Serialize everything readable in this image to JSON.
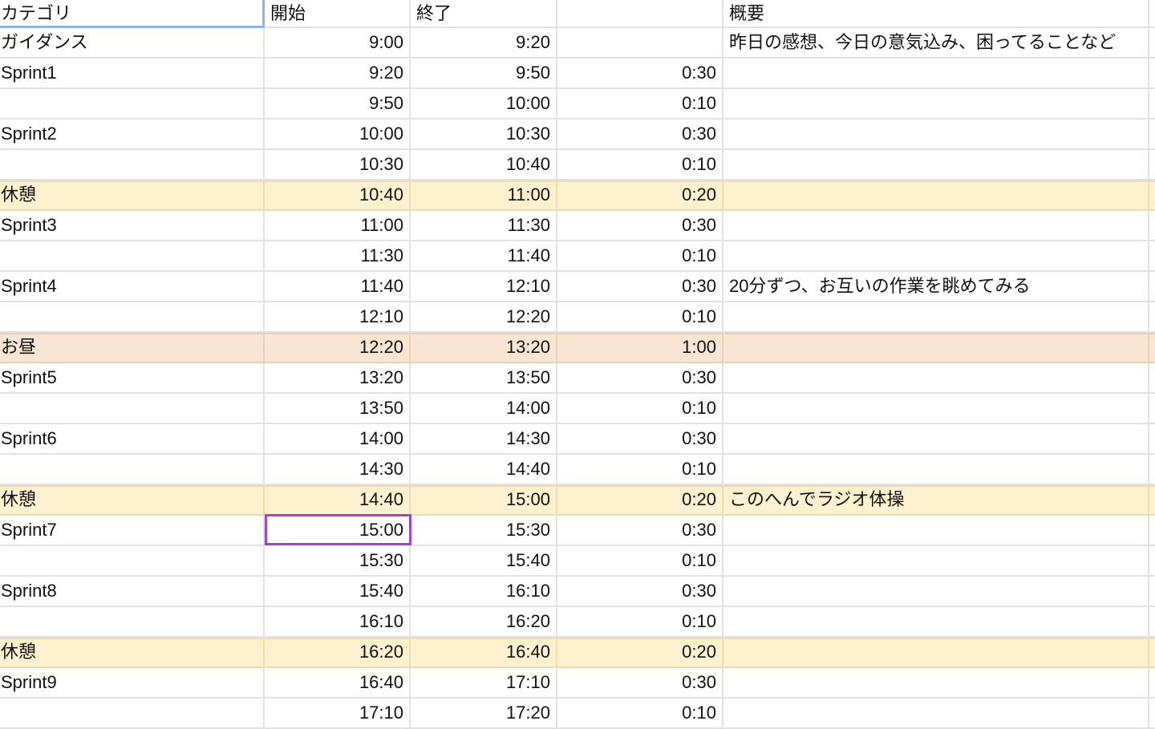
{
  "headers": [
    "カテゴリ",
    "開始",
    "終了",
    "",
    "概要"
  ],
  "rows": [
    {
      "category": "ガイダンス",
      "start": "9:00",
      "end": "9:20",
      "duration": "",
      "summary": "昨日の感想、今日の意気込み、困ってることなど",
      "type": "normal"
    },
    {
      "category": "Sprint1",
      "start": "9:20",
      "end": "9:50",
      "duration": "0:30",
      "summary": "",
      "type": "normal"
    },
    {
      "category": "",
      "start": "9:50",
      "end": "10:00",
      "duration": "0:10",
      "summary": "",
      "type": "normal"
    },
    {
      "category": "Sprint2",
      "start": "10:00",
      "end": "10:30",
      "duration": "0:30",
      "summary": "",
      "type": "normal"
    },
    {
      "category": "",
      "start": "10:30",
      "end": "10:40",
      "duration": "0:10",
      "summary": "",
      "type": "normal"
    },
    {
      "category": "休憩",
      "start": "10:40",
      "end": "11:00",
      "duration": "0:20",
      "summary": "",
      "type": "break"
    },
    {
      "category": "Sprint3",
      "start": "11:00",
      "end": "11:30",
      "duration": "0:30",
      "summary": "",
      "type": "normal"
    },
    {
      "category": "",
      "start": "11:30",
      "end": "11:40",
      "duration": "0:10",
      "summary": "",
      "type": "normal"
    },
    {
      "category": "Sprint4",
      "start": "11:40",
      "end": "12:10",
      "duration": "0:30",
      "summary": "20分ずつ、お互いの作業を眺めてみる",
      "type": "normal"
    },
    {
      "category": "",
      "start": "12:10",
      "end": "12:20",
      "duration": "0:10",
      "summary": "",
      "type": "normal"
    },
    {
      "category": "お昼",
      "start": "12:20",
      "end": "13:20",
      "duration": "1:00",
      "summary": "",
      "type": "lunch"
    },
    {
      "category": "Sprint5",
      "start": "13:20",
      "end": "13:50",
      "duration": "0:30",
      "summary": "",
      "type": "normal"
    },
    {
      "category": "",
      "start": "13:50",
      "end": "14:00",
      "duration": "0:10",
      "summary": "",
      "type": "normal"
    },
    {
      "category": "Sprint6",
      "start": "14:00",
      "end": "14:30",
      "duration": "0:30",
      "summary": "",
      "type": "normal"
    },
    {
      "category": "",
      "start": "14:30",
      "end": "14:40",
      "duration": "0:10",
      "summary": "",
      "type": "normal"
    },
    {
      "category": "休憩",
      "start": "14:40",
      "end": "15:00",
      "duration": "0:20",
      "summary": "このへんでラジオ体操",
      "type": "break"
    },
    {
      "category": "Sprint7",
      "start": "15:00",
      "end": "15:30",
      "duration": "0:30",
      "summary": "",
      "type": "normal"
    },
    {
      "category": "",
      "start": "15:30",
      "end": "15:40",
      "duration": "0:10",
      "summary": "",
      "type": "normal"
    },
    {
      "category": "Sprint8",
      "start": "15:40",
      "end": "16:10",
      "duration": "0:30",
      "summary": "",
      "type": "normal"
    },
    {
      "category": "",
      "start": "16:10",
      "end": "16:20",
      "duration": "0:10",
      "summary": "",
      "type": "normal"
    },
    {
      "category": "休憩",
      "start": "16:20",
      "end": "16:40",
      "duration": "0:20",
      "summary": "",
      "type": "break"
    },
    {
      "category": "Sprint9",
      "start": "16:40",
      "end": "17:10",
      "duration": "0:30",
      "summary": "",
      "type": "normal"
    },
    {
      "category": "",
      "start": "17:10",
      "end": "17:20",
      "duration": "0:10",
      "summary": "",
      "type": "normal"
    }
  ],
  "colors": {
    "break": "#fdf1cf",
    "lunch": "#f9e5d3",
    "grid": "#e2e2e2",
    "selection": "#9b47c9",
    "header_selection": "#8ab6e0"
  }
}
